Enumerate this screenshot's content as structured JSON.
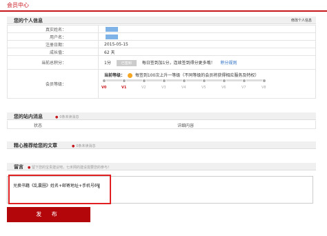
{
  "page_title": "会员中心",
  "profile": {
    "title": "您的个人信息",
    "edit_link": "修改个人信息",
    "real_name_label": "真实姓名：",
    "real_name_value": "",
    "username_label": "用户名：",
    "username_value": "",
    "register_date_label": "注册日期：",
    "register_date_value": "2015-05-15",
    "member_age_label": "成长值：",
    "member_age_value": "62 天",
    "points_label": "当前总积分：",
    "points_value": "1分",
    "signed_button": "已签到",
    "points_note": "每日签到加1分，连续签到得分更多哦！",
    "rules_link": "积分规则",
    "level_label": "会员等级：",
    "current_level_label": "当前等级：",
    "level_note": "每签到100次上升一等级（不同等级的会员将获得相应服务及特权）",
    "levels": [
      "V0",
      "V1",
      "V2",
      "V3",
      "V4",
      "V5",
      "V6",
      "V7",
      "V8"
    ],
    "current_level_index": 1
  },
  "messages": {
    "title": "您的站内消息",
    "hint": "0条未读消息",
    "status_header": "状态",
    "detail_header": "详细内容"
  },
  "recommend": {
    "title": "精心推荐给您的文章",
    "hint": "0条未读消息"
  },
  "comment": {
    "title": "留言",
    "hint": "留下您的宝贵建议吧，七禾网的建设需要您的参与！",
    "value": "兑换书籍《乱囊圈》姓名+邮寄地址+手机号码"
  },
  "publish_button": "发 布"
}
